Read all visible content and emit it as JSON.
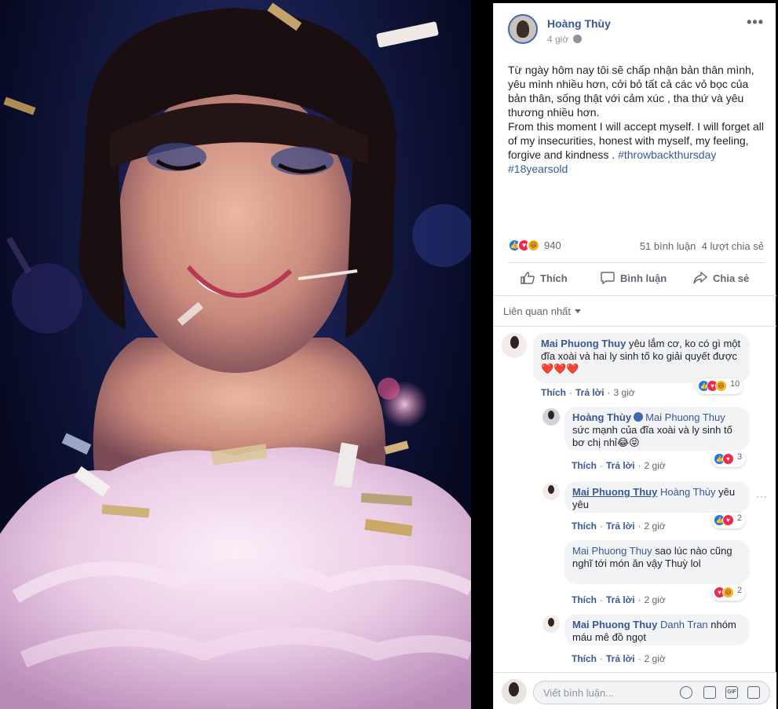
{
  "post": {
    "author": "Hoàng Thùy",
    "time": "4 giờ",
    "text_lines": [
      "Từ ngày hôm nay tôi sẽ chấp nhận bản thân mình,",
      "yêu mình nhiều hơn, cởi bỏ tất cả các vỏ bọc của",
      "bản thân, sống thật với cảm xúc , tha thứ và yêu",
      "thương nhiều hơn.",
      "From this moment I will accept myself. I will forget all",
      "of my insecurities, honest with myself, my feeling,"
    ],
    "text_last_prefix": "forgive and kindness . ",
    "hashtag1": "#throwbackthursday",
    "hashtag2": "#18yearsold",
    "reaction_count": "940",
    "comments_count": "51 bình luận",
    "shares_count": "4 lượt chia sẻ"
  },
  "actions": {
    "like": "Thích",
    "comment": "Bình luận",
    "share": "Chia sẻ"
  },
  "sort": {
    "label": "Liên quan nhất"
  },
  "comments": [
    {
      "name": "Mai Phuong Thuy",
      "text": "yêu lắm cơ, ko có gì một đĩa xoài và hai ly sinh tố ko giải quyết được",
      "emoji": "❤️❤️❤️",
      "like": "Thích",
      "reply": "Trả lời",
      "time": "3 giờ",
      "reactions": "10"
    },
    {
      "name": "Hoàng Thùy",
      "mention": "Mai Phuong Thuy",
      "text": "sức mạnh của đĩa xoài và ly sinh tố bơ chị nhỉ😂😝",
      "like": "Thích",
      "reply": "Trả lời",
      "time": "2 giờ",
      "reactions": "3"
    },
    {
      "name": "Mai Phuong Thuy",
      "mention": "Hoàng Thùy",
      "text": "yêu yêu",
      "like": "Thích",
      "reply": "Trả lời",
      "time": "2 giờ",
      "reactions": "2"
    },
    {
      "name": "Mai Phuong Thuy",
      "text": "sao lúc nào cũng nghĩ tới món ăn vậy Thuỳ lol",
      "like": "Thích",
      "reply": "Trả lời",
      "time": "2 giờ",
      "reactions": "2"
    },
    {
      "name": "Mai Phuong Thuy",
      "mention": "Danh Tran",
      "text": "nhóm máu mê đồ ngọt",
      "like": "Thích",
      "reply": "Trả lời",
      "time": "2 giờ"
    }
  ],
  "composer": {
    "placeholder": "Viết bình luận..."
  },
  "colors": {
    "link": "#385898",
    "like": "#1877f2",
    "love": "#f0284a",
    "haha": "#f7b125"
  }
}
